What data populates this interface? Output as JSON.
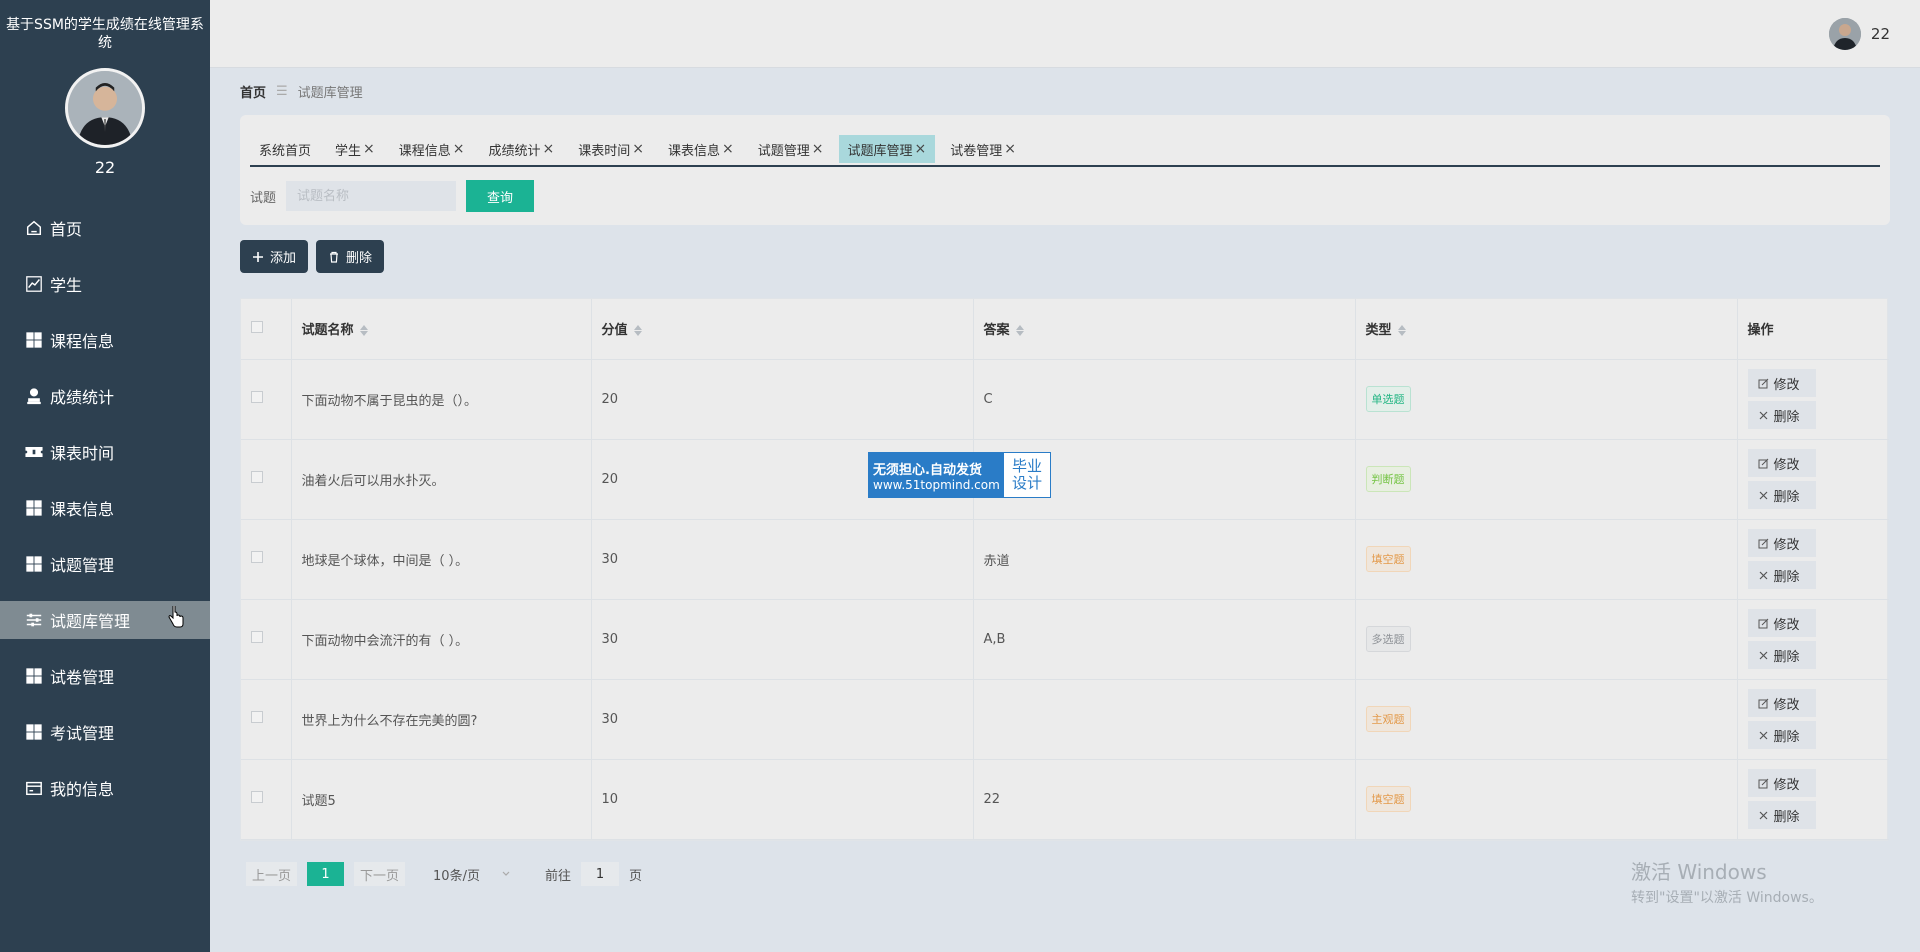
{
  "sidebar": {
    "app_title": "基于SSM的学生成绩在线管理系统",
    "username": "22",
    "items": [
      {
        "label": "首页",
        "icon": "home-icon"
      },
      {
        "label": "学生",
        "icon": "chart-icon"
      },
      {
        "label": "课程信息",
        "icon": "grid-icon"
      },
      {
        "label": "成绩统计",
        "icon": "user-stamp-icon"
      },
      {
        "label": "课表时间",
        "icon": "ticket-icon"
      },
      {
        "label": "课表信息",
        "icon": "grid-icon"
      },
      {
        "label": "试题管理",
        "icon": "grid-icon"
      },
      {
        "label": "试题库管理",
        "icon": "sliders-icon"
      },
      {
        "label": "试卷管理",
        "icon": "grid-icon"
      },
      {
        "label": "考试管理",
        "icon": "grid-icon"
      },
      {
        "label": "我的信息",
        "icon": "card-icon"
      }
    ]
  },
  "topbar": {
    "username": "22"
  },
  "breadcrumb": {
    "home": "首页",
    "current": "试题库管理"
  },
  "tabs": [
    {
      "label": "系统首页",
      "closable": false
    },
    {
      "label": "学生",
      "closable": true
    },
    {
      "label": "课程信息",
      "closable": true
    },
    {
      "label": "成绩统计",
      "closable": true
    },
    {
      "label": "课表时间",
      "closable": true
    },
    {
      "label": "课表信息",
      "closable": true
    },
    {
      "label": "试题管理",
      "closable": true
    },
    {
      "label": "试题库管理",
      "closable": true,
      "active": true
    },
    {
      "label": "试卷管理",
      "closable": true
    }
  ],
  "tab_close_glyph": "×",
  "search": {
    "label": "试题",
    "placeholder": "试题名称",
    "button": "查询"
  },
  "actions": {
    "add": "添加",
    "delete": "删除"
  },
  "table": {
    "headers": [
      "试题名称",
      "分值",
      "答案",
      "类型",
      "操作"
    ],
    "rows": [
      {
        "name": "下面动物不属于昆虫的是（）。",
        "score": "20",
        "answer": "C",
        "type": "单选题"
      },
      {
        "name": "油着火后可以用水扑灭。",
        "score": "20",
        "answer": "",
        "type": "判断题"
      },
      {
        "name": "地球是个球体，中间是（ ）。",
        "score": "30",
        "answer": "赤道",
        "type": "填空题"
      },
      {
        "name": "下面动物中会流汗的有（ ）。",
        "score": "30",
        "answer": "A,B",
        "type": "多选题"
      },
      {
        "name": "世界上为什么不存在完美的圆?",
        "score": "30",
        "answer": "",
        "type": "主观题"
      },
      {
        "name": "试题5",
        "score": "10",
        "answer": "22",
        "type": "填空题"
      }
    ],
    "edit_label": "修改",
    "delete_label": "删除"
  },
  "type_colors": {
    "单选题": {
      "bg": "#e3efe9",
      "border": "#b9e2d2",
      "color": "#23b683"
    },
    "判断题": {
      "bg": "#e8efe1",
      "border": "#cbe6b8",
      "color": "#75c445"
    },
    "填空题": {
      "bg": "#efe6dc",
      "border": "#f1d6b8",
      "color": "#e39a4b"
    },
    "多选题": {
      "bg": "#e6e7e8",
      "border": "#d5d7da",
      "color": "#8f9398"
    },
    "主观题": {
      "bg": "#efe6dc",
      "border": "#f1d6b8",
      "color": "#e39a4b"
    }
  },
  "watermark": {
    "line1": "无须担心.自动发货",
    "line2": "www.51topmind.com",
    "right1": "毕业",
    "right2": "设计"
  },
  "pagination": {
    "prev": "上一页",
    "current": "1",
    "next": "下一页",
    "page_size": "10条/页",
    "goto_label": "前往",
    "goto_value": "1",
    "goto_suffix": "页"
  },
  "activation": {
    "line1": "激活 Windows",
    "line2": "转到\"设置\"以激活 Windows。"
  },
  "colors": {
    "sidebar": "#2d4050",
    "accent": "#1bb394",
    "active_tab": "#a9d8dc"
  }
}
